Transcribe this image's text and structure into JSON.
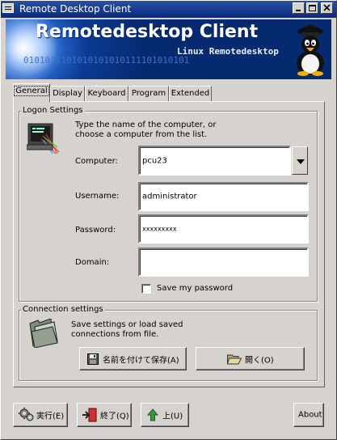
{
  "window": {
    "title": "Remote Desktop Client",
    "controls": [
      "minimize",
      "maximize",
      "close"
    ]
  },
  "banner": {
    "title": "Remotedesktop Client",
    "subtitle": "Linux Remotedesktop",
    "binary": "0101011101010101010111101010101"
  },
  "tabs": [
    {
      "label": "General",
      "active": true
    },
    {
      "label": "Display",
      "active": false
    },
    {
      "label": "Keyboard",
      "active": false
    },
    {
      "label": "Program",
      "active": false
    },
    {
      "label": "Extended",
      "active": false
    }
  ],
  "logon": {
    "group_title": "Logon Settings",
    "instruction_line1": "Type the name of the computer, or",
    "instruction_line2": "choose a computer from the list.",
    "computer_label": "Computer:",
    "computer_value": "pcu23",
    "username_label": "Username:",
    "username_value": "administrator",
    "password_label": "Password:",
    "password_value": "xxxxxxxxx",
    "domain_label": "Domain:",
    "domain_value": "",
    "save_password_label": "Save my password",
    "save_password_checked": false
  },
  "connection": {
    "group_title": "Connection settings",
    "text_line1": "Save settings or load saved",
    "text_line2": "connections from file.",
    "save_as_label": "名前を付けて保存(A)",
    "open_label": "開く(O)"
  },
  "footer": {
    "run_label": "実行(E)",
    "exit_label": "終了(Q)",
    "up_label": "上(U)",
    "about_label": "About"
  },
  "colors": {
    "titlebar": "#0a2a7a",
    "face": "#d6d3ce",
    "banner_blue": "#0c3b93"
  }
}
